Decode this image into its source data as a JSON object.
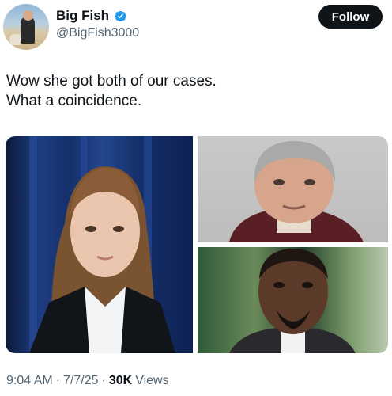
{
  "header": {
    "display_name": "Big Fish",
    "handle": "@BigFish3000",
    "follow_label": "Follow",
    "avatar_icon": "profile-photo"
  },
  "tweet": {
    "lines": [
      "Wow she got both of our cases.",
      "What a coincidence."
    ]
  },
  "media": {
    "count": 3,
    "items": [
      {
        "icon": "photo-woman-courtroom"
      },
      {
        "icon": "photo-gray-haired-man"
      },
      {
        "icon": "photo-bald-man-beard"
      }
    ]
  },
  "footer": {
    "time": "9:04 AM",
    "date": "7/7/25",
    "views_count": "30K",
    "views_label": "Views",
    "separator": "·"
  },
  "colors": {
    "text": "#0f1419",
    "secondary": "#536471",
    "verified": "#1d9bf0",
    "follow_bg": "#0f1419"
  }
}
